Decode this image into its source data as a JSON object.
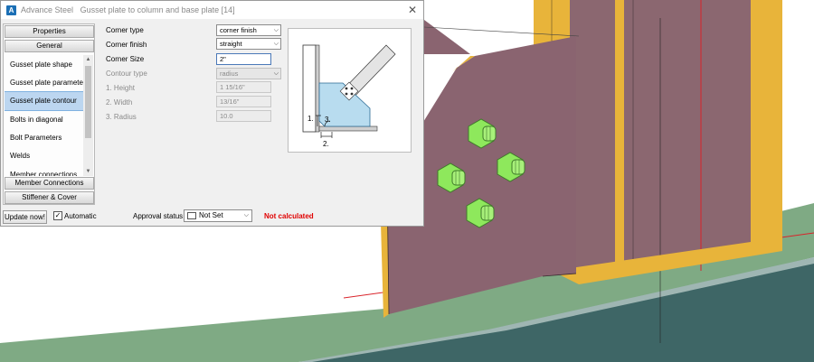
{
  "window": {
    "app_name": "Advance Steel",
    "title": "Gusset plate to column and base plate [14]",
    "close_glyph": "✕",
    "app_logo_letter": "A"
  },
  "nav": {
    "top_headers": [
      "Properties",
      "General"
    ],
    "items": [
      {
        "label": "Gusset plate shape",
        "selected": false
      },
      {
        "label": "Gusset plate parameter",
        "selected": false
      },
      {
        "label": "Gusset plate contour",
        "selected": true
      },
      {
        "label": "Bolts in diagonal",
        "selected": false
      },
      {
        "label": "Bolt Parameters",
        "selected": false
      },
      {
        "label": "Welds",
        "selected": false
      },
      {
        "label": "Member connections",
        "selected": false
      }
    ],
    "bottom_headers": [
      "Member Connections",
      "Stiffener & Cover"
    ]
  },
  "form": {
    "corner_type": {
      "label": "Corner type",
      "value": "corner finish"
    },
    "corner_finish": {
      "label": "Corner finish",
      "value": "straight"
    },
    "corner_size": {
      "label": "Corner Size",
      "value": "2\""
    },
    "contour_type": {
      "label": "Contour type",
      "value": "radius"
    },
    "height": {
      "label": "1. Height",
      "value": "1 15/16\""
    },
    "width": {
      "label": "2. Width",
      "value": "13/16\""
    },
    "radius": {
      "label": "3. Radius",
      "value": "10.0"
    }
  },
  "diagram": {
    "label_1": "1.",
    "label_2": "2.",
    "label_3": "3."
  },
  "bottom_bar": {
    "update_label": "Update now!",
    "automatic_label": "Automatic",
    "automatic_checked": "✓",
    "approval_label": "Approval status",
    "approval_value": "Not Set",
    "status": "Not calculated"
  },
  "icons": {
    "dropdown": "chevron-down-icon",
    "scroll_up": "chevron-up-icon",
    "scroll_down": "chevron-down-icon"
  },
  "colors": {
    "selection": "#bcd6f0",
    "status_red": "#e00000",
    "plate": "#8a6470",
    "column_yellow": "#e8b43a",
    "bolt_green": "#8ee85c",
    "ground_green": "#7faa84",
    "slab": "#3d6464"
  }
}
